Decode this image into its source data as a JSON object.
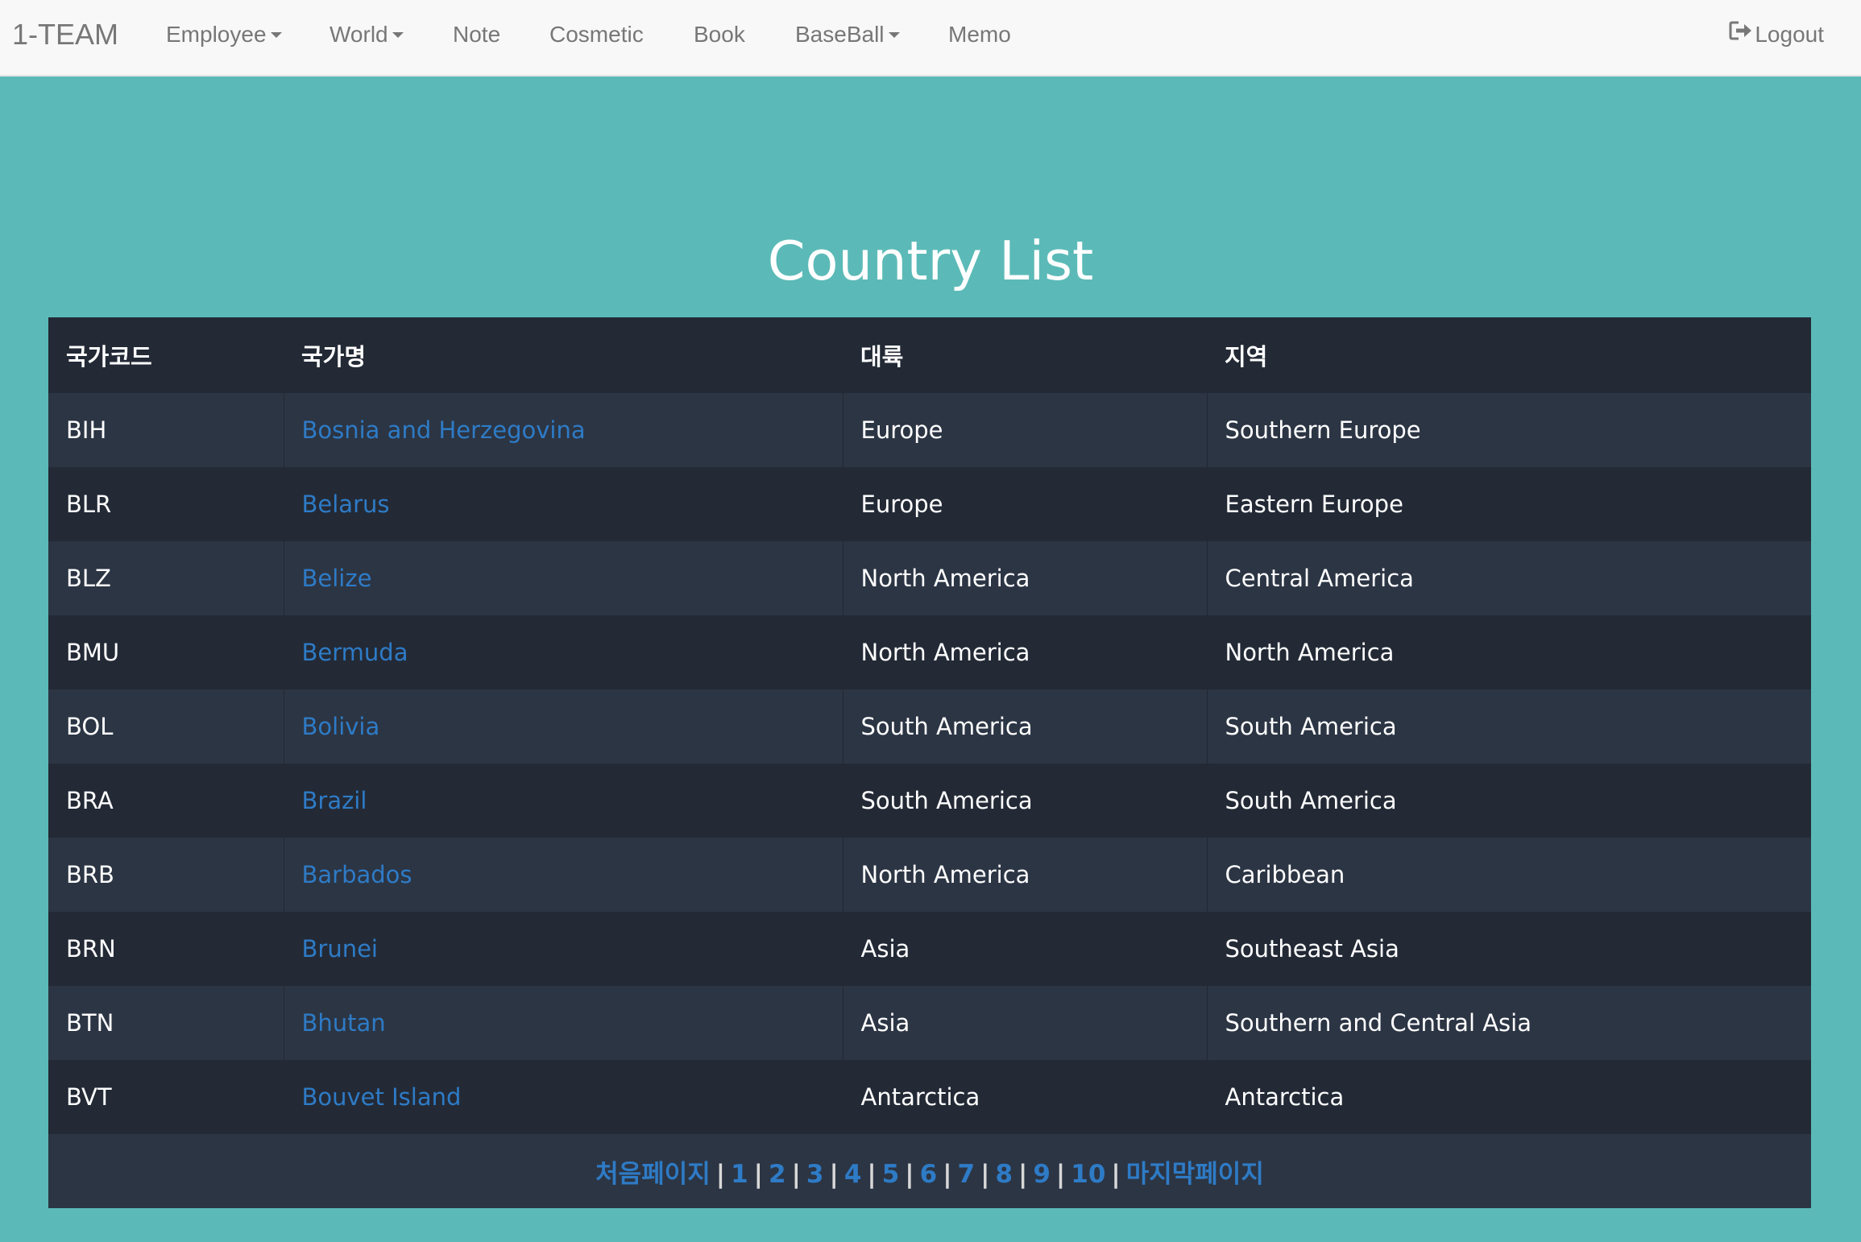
{
  "navbar": {
    "brand": "1-TEAM",
    "items": [
      {
        "label": "Employee",
        "dropdown": true
      },
      {
        "label": "World",
        "dropdown": true
      },
      {
        "label": "Note",
        "dropdown": false
      },
      {
        "label": "Cosmetic",
        "dropdown": false
      },
      {
        "label": "Book",
        "dropdown": false
      },
      {
        "label": "BaseBall",
        "dropdown": true
      },
      {
        "label": "Memo",
        "dropdown": false
      }
    ],
    "logout_label": "Logout",
    "logout_icon": "logout-icon"
  },
  "main": {
    "title": "Country List",
    "table": {
      "headers": [
        "국가코드",
        "국가명",
        "대륙",
        "지역"
      ],
      "rows": [
        {
          "code": "BIH",
          "name": "Bosnia and Herzegovina",
          "continent": "Europe",
          "region": "Southern Europe"
        },
        {
          "code": "BLR",
          "name": "Belarus",
          "continent": "Europe",
          "region": "Eastern Europe"
        },
        {
          "code": "BLZ",
          "name": "Belize",
          "continent": "North America",
          "region": "Central America"
        },
        {
          "code": "BMU",
          "name": "Bermuda",
          "continent": "North America",
          "region": "North America"
        },
        {
          "code": "BOL",
          "name": "Bolivia",
          "continent": "South America",
          "region": "South America"
        },
        {
          "code": "BRA",
          "name": "Brazil",
          "continent": "South America",
          "region": "South America"
        },
        {
          "code": "BRB",
          "name": "Barbados",
          "continent": "North America",
          "region": "Caribbean"
        },
        {
          "code": "BRN",
          "name": "Brunei",
          "continent": "Asia",
          "region": "Southeast Asia"
        },
        {
          "code": "BTN",
          "name": "Bhutan",
          "continent": "Asia",
          "region": "Southern and Central Asia"
        },
        {
          "code": "BVT",
          "name": "Bouvet Island",
          "continent": "Antarctica",
          "region": "Antarctica"
        }
      ]
    },
    "pagination": {
      "first_label": "처음페이지",
      "pages": [
        "1",
        "2",
        "3",
        "4",
        "5",
        "6",
        "7",
        "8",
        "9",
        "10"
      ],
      "last_label": "마지막페이지",
      "separator": "|"
    }
  },
  "colors": {
    "background": "#5bbab7",
    "navbar": "#f8f8f8",
    "table_dark": "#232a36",
    "table_light": "#2c3544",
    "link": "#2e7bc6"
  }
}
